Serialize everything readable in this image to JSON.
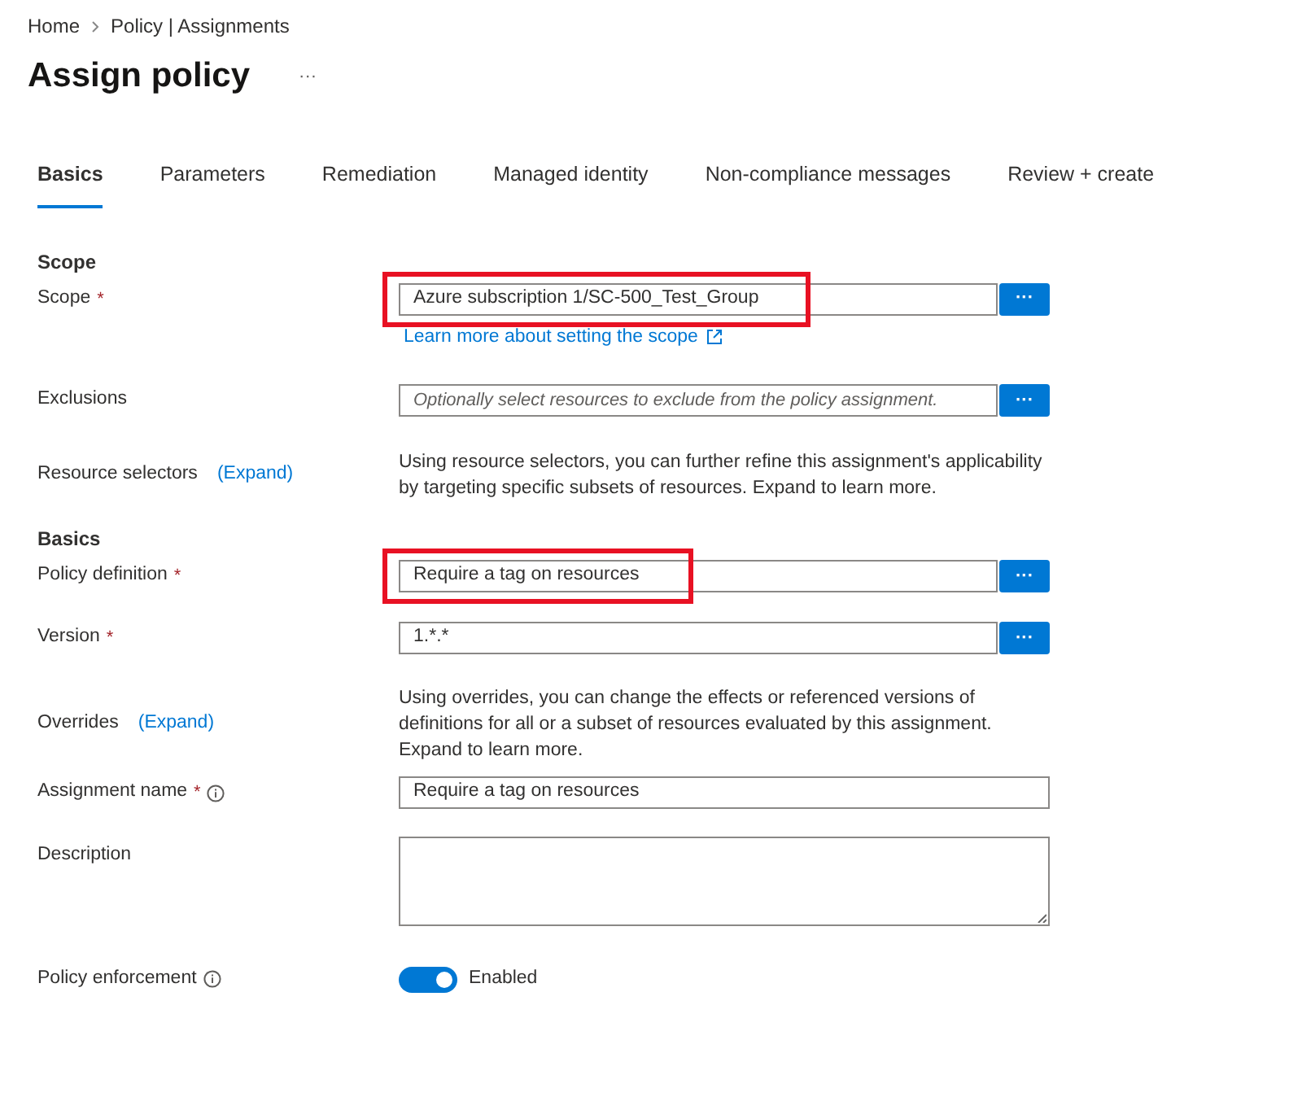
{
  "breadcrumb": [
    {
      "label": "Home"
    },
    {
      "label": "Policy | Assignments"
    }
  ],
  "title": "Assign policy",
  "more": "···",
  "tabs": [
    {
      "label": "Basics",
      "selected": true
    },
    {
      "label": "Parameters",
      "selected": false
    },
    {
      "label": "Remediation",
      "selected": false
    },
    {
      "label": "Managed identity",
      "selected": false
    },
    {
      "label": "Non-compliance messages",
      "selected": false
    },
    {
      "label": "Review + create",
      "selected": false
    }
  ],
  "rows": [
    {
      "kind": "heading",
      "label": "Scope"
    },
    {
      "kind": "picker",
      "label": "Scope",
      "required_mark": "*",
      "value": "Azure subscription 1/SC-500_Test_Group",
      "highlighted": true,
      "button": "···",
      "link": "Learn more about setting the scope"
    },
    {
      "kind": "picker",
      "label": "Exclusions",
      "placeholder": "Optionally select resources to exclude from the policy assignment.",
      "button": "···"
    },
    {
      "kind": "note",
      "label": "Resource selectors",
      "expand": "(Expand)",
      "text": "Using resource selectors, you can further refine this assignment's applicability by targeting specific subsets of resources. Expand to learn more."
    },
    {
      "kind": "heading",
      "label": "Basics"
    },
    {
      "kind": "picker",
      "label": "Policy definition",
      "required_mark": "*",
      "value": "Require a tag on resources",
      "highlighted": true,
      "button": "···"
    },
    {
      "kind": "picker",
      "label": "Version",
      "required_mark": "*",
      "value": "1.*.*",
      "button": "···"
    },
    {
      "kind": "note",
      "label": "Overrides",
      "expand": "(Expand)",
      "text": "Using overrides, you can change the effects or referenced versions of definitions for all or a subset of resources evaluated by this assignment. Expand to learn more."
    },
    {
      "kind": "text",
      "label": "Assignment name",
      "required_mark": "*",
      "info": true,
      "value": "Require a tag on resources"
    },
    {
      "kind": "textarea",
      "label": "Description"
    },
    {
      "kind": "toggle",
      "label": "Policy enforcement",
      "info": true,
      "on": true,
      "text": "Enabled"
    }
  ]
}
